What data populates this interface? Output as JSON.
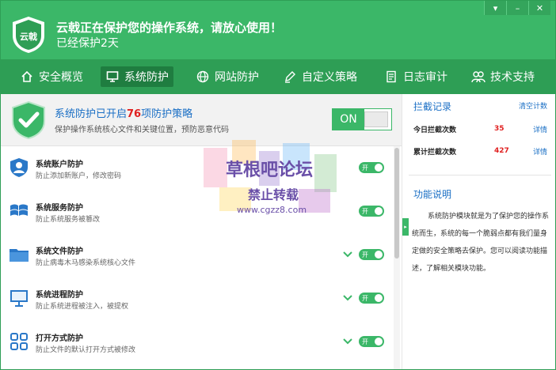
{
  "window": {
    "controls": [
      "▾",
      "–",
      "✕"
    ]
  },
  "header": {
    "logo_text": "云戟",
    "status_title": "云戟正在保护您的操作系统，请放心使用！",
    "status_sub": "已经保护2天"
  },
  "nav": {
    "items": [
      {
        "label": "安全概览",
        "icon": "home-icon"
      },
      {
        "label": "系统防护",
        "icon": "monitor-icon"
      },
      {
        "label": "网站防护",
        "icon": "globe-icon"
      },
      {
        "label": "自定义策略",
        "icon": "pen-icon"
      },
      {
        "label": "日志审计",
        "icon": "document-icon"
      },
      {
        "label": "技术支持",
        "icon": "users-icon"
      }
    ],
    "active_index": 1
  },
  "summary": {
    "title_prefix": "系统防护已开启",
    "count": "76",
    "title_suffix": "项防护策略",
    "desc": "保护操作系统核心文件和关键位置，预防恶意代码",
    "toggle_label": "ON"
  },
  "modules": [
    {
      "title": "系统账户防护",
      "desc": "防止添加新账户，修改密码",
      "icon": "user-shield-icon",
      "switch": "开",
      "expandable": false
    },
    {
      "title": "系统服务防护",
      "desc": "防止系统服务被篡改",
      "icon": "windows-icon",
      "switch": "开",
      "expandable": false
    },
    {
      "title": "系统文件防护",
      "desc": "防止病毒木马感染系统核心文件",
      "icon": "folder-icon",
      "switch": "开",
      "expandable": true
    },
    {
      "title": "系统进程防护",
      "desc": "防止系统进程被注入，被提权",
      "icon": "monitor-icon",
      "switch": "开",
      "expandable": true
    },
    {
      "title": "打开方式防护",
      "desc": "防止文件的默认打开方式被修改",
      "icon": "grid-icon",
      "switch": "开",
      "expandable": true
    }
  ],
  "sidepanel": {
    "intercept_title": "拦截记录",
    "clear_link": "清空计数",
    "today_label": "今日拦截次数",
    "today_value": "35",
    "total_label": "累计拦截次数",
    "total_value": "427",
    "detail_link": "详情",
    "function_title": "功能说明",
    "function_desc": "系统防护模块就是为了保护您的操作系统而生，系统的每一个脆弱点都有我们量身定做的安全策略去保护。您可以阅读功能描述，了解相关模块功能。"
  },
  "watermark": {
    "line1": "草根吧论坛",
    "line2": "禁止转载",
    "line3": "www.cgzz8.com"
  },
  "colors": {
    "brand_green": "#3bb768",
    "nav_green": "#2e9e55",
    "active_nav": "#1f7d40",
    "link_blue": "#1a6fc5",
    "alert_red": "#e02020"
  }
}
